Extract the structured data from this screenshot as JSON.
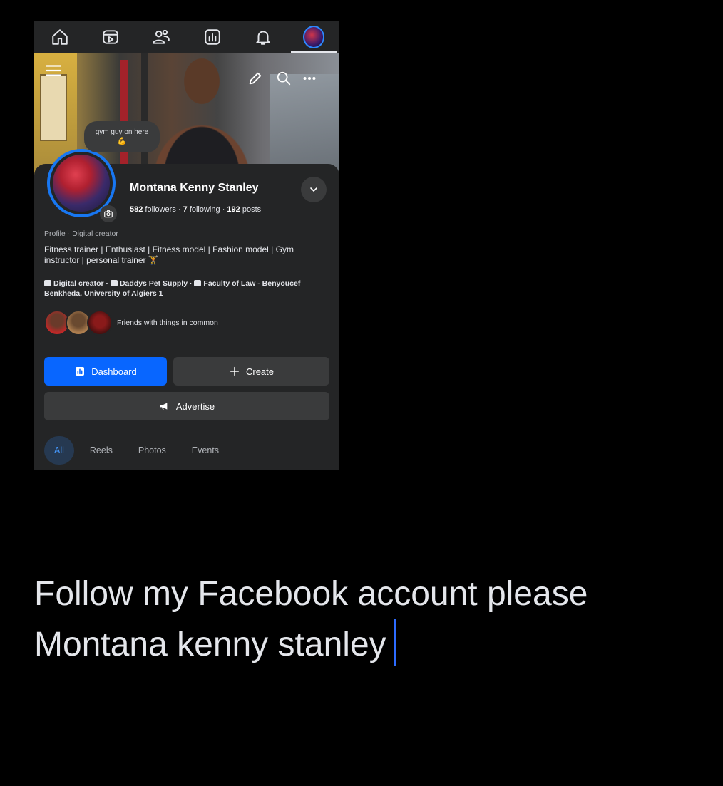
{
  "topnav": {
    "items": [
      "home-icon",
      "video-icon",
      "friends-icon",
      "insights-icon",
      "bell-icon",
      "avatar"
    ]
  },
  "note": {
    "text": "gym guy on here",
    "emoji": "💪"
  },
  "profile": {
    "name": "Montana Kenny Stanley",
    "followers_count": "582",
    "followers_label": "followers",
    "following_count": "7",
    "following_label": "following",
    "posts_count": "192",
    "posts_label": "posts",
    "kind": "Profile · Digital creator",
    "bio": "Fitness trainer | Enthusiast | Fitness model | Fashion model | Gym instructor | personal trainer 🏋",
    "details": {
      "category": "Digital creator",
      "work": "Daddys Pet Supply",
      "education": "Faculty of Law - Benyoucef Benkheda, University of Algiers 1"
    },
    "friends_text": "Friends with things in common"
  },
  "buttons": {
    "dashboard": "Dashboard",
    "create": "Create",
    "advertise": "Advertise"
  },
  "tabs": [
    "All",
    "Reels",
    "Photos",
    "Events"
  ],
  "caption": {
    "line1": "Follow my Facebook account please",
    "line2": "Montana kenny stanley"
  },
  "colors": {
    "accent": "#0866ff",
    "background": "#000000",
    "panel": "#242526",
    "caret": "#2d6bff"
  }
}
